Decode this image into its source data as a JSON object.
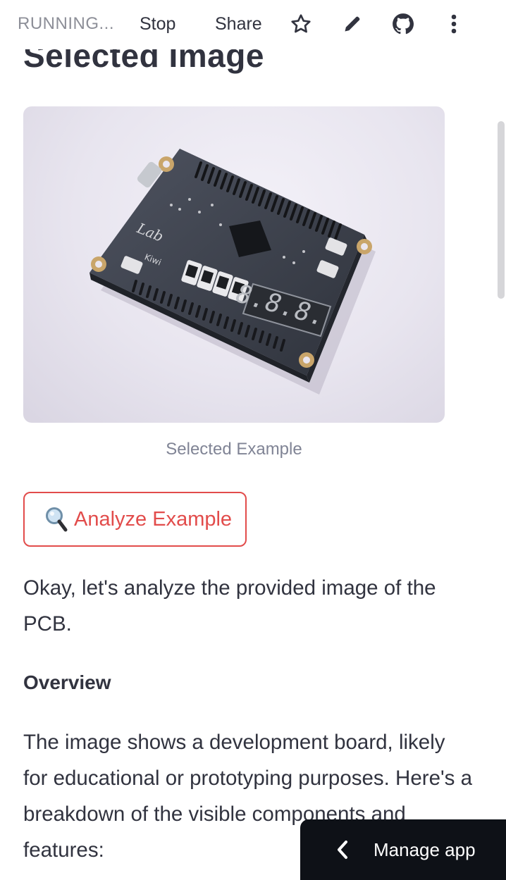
{
  "toolbar": {
    "status": "RUNNING...",
    "stop_label": "Stop",
    "share_label": "Share",
    "icons": [
      "star-icon",
      "pencil-icon",
      "github-icon",
      "more-vertical-icon"
    ]
  },
  "main": {
    "heading": "Selected Image",
    "image_caption": "Selected Example",
    "board_silkscreen": {
      "brand": "Lab",
      "model": "Kiwi",
      "display_digits": "8.8.8."
    },
    "analyze_button": {
      "icon": "magnifier-icon",
      "label": "Analyze Example"
    },
    "intro": "Okay, let's analyze the provided image of the PCB.",
    "section_heading": "Overview",
    "overview_text": "The image shows a development board, likely for educational or prototyping purposes. Here's a breakdown of the visible components and features:"
  },
  "manage_app": {
    "label": "Manage app",
    "icon": "chevron-left-icon"
  },
  "colors": {
    "accent": "#e24c4b",
    "text": "#31333f",
    "muted": "#808495",
    "dark_panel": "#0e1117"
  }
}
